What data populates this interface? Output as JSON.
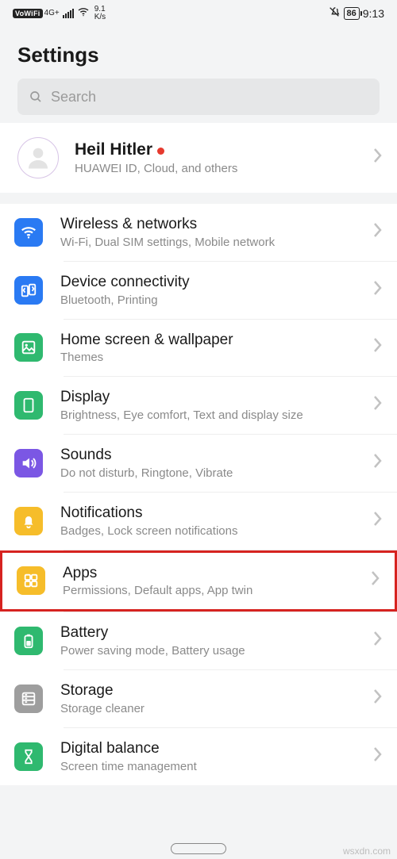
{
  "status": {
    "vowifi": "VoWiFi",
    "network": "4G+",
    "speed_top": "9.1",
    "speed_bottom": "K/s",
    "battery": "86",
    "time": "9:13"
  },
  "page_title": "Settings",
  "search": {
    "placeholder": "Search"
  },
  "profile": {
    "name": "Heil Hitler",
    "subtitle": "HUAWEI ID, Cloud, and others"
  },
  "items": [
    {
      "title": "Wireless & networks",
      "subtitle": "Wi-Fi, Dual SIM settings, Mobile network",
      "icon": "wifi",
      "bg": "bg-blue"
    },
    {
      "title": "Device connectivity",
      "subtitle": "Bluetooth, Printing",
      "icon": "connectivity",
      "bg": "bg-blue"
    },
    {
      "title": "Home screen & wallpaper",
      "subtitle": "Themes",
      "icon": "wallpaper",
      "bg": "bg-green"
    },
    {
      "title": "Display",
      "subtitle": "Brightness, Eye comfort, Text and display size",
      "icon": "display",
      "bg": "bg-green"
    },
    {
      "title": "Sounds",
      "subtitle": "Do not disturb, Ringtone, Vibrate",
      "icon": "sounds",
      "bg": "bg-purple"
    },
    {
      "title": "Notifications",
      "subtitle": "Badges, Lock screen notifications",
      "icon": "notifications",
      "bg": "bg-amber"
    },
    {
      "title": "Apps",
      "subtitle": "Permissions, Default apps, App twin",
      "icon": "apps",
      "bg": "bg-amber",
      "highlighted": true
    },
    {
      "title": "Battery",
      "subtitle": "Power saving mode, Battery usage",
      "icon": "battery",
      "bg": "bg-green"
    },
    {
      "title": "Storage",
      "subtitle": "Storage cleaner",
      "icon": "storage",
      "bg": "bg-gray"
    },
    {
      "title": "Digital balance",
      "subtitle": "Screen time management",
      "icon": "balance",
      "bg": "bg-green"
    }
  ],
  "watermark": "wsxdn.com"
}
